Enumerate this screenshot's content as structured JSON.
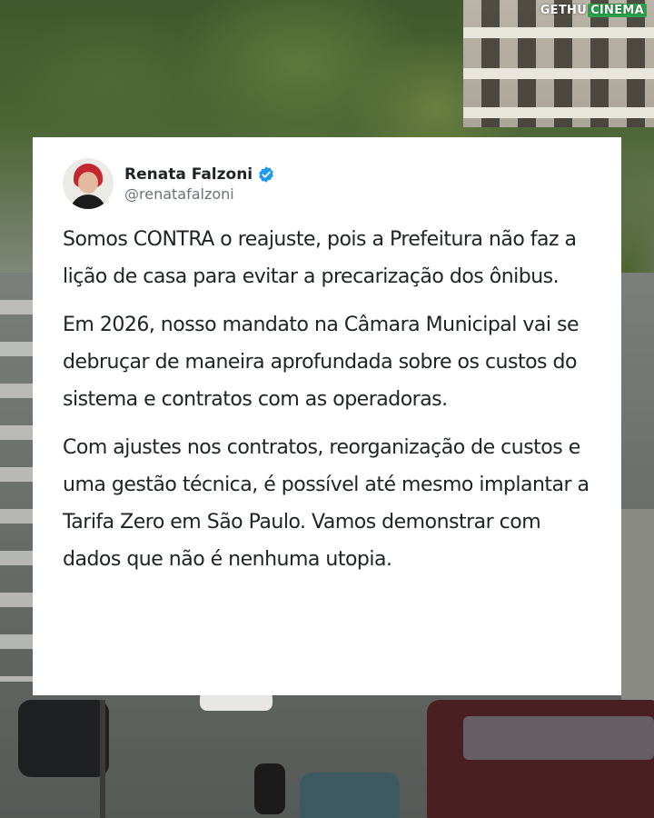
{
  "watermark": {
    "prefix": "GETHU",
    "suffix": "CINEMA"
  },
  "tweet": {
    "author_name": "Renata Falzoni",
    "handle": "@renatafalzoni",
    "verified": true,
    "paragraphs": [
      "Somos CONTRA o reajuste, pois a Prefeitura não faz a lição de casa para evitar a precarização dos ônibus.",
      "Em 2026, nosso mandato na Câmara Municipal vai se debruçar de maneira aprofundada sobre os custos do sistema e contratos com as operadoras.",
      "Com ajustes nos contratos, reorganização de custos e uma gestão técnica, é possível até mesmo implantar a Tarifa Zero em São Paulo. Vamos demonstrar com dados que não é nenhuma utopia."
    ]
  },
  "colors": {
    "verified_badge": "#1d9bf0",
    "card_background": "#ffffff",
    "text": "#202427",
    "handle": "#6d7379",
    "watermark_box": "#2aa34a"
  },
  "icons": {
    "verified": "verified-badge-icon"
  }
}
